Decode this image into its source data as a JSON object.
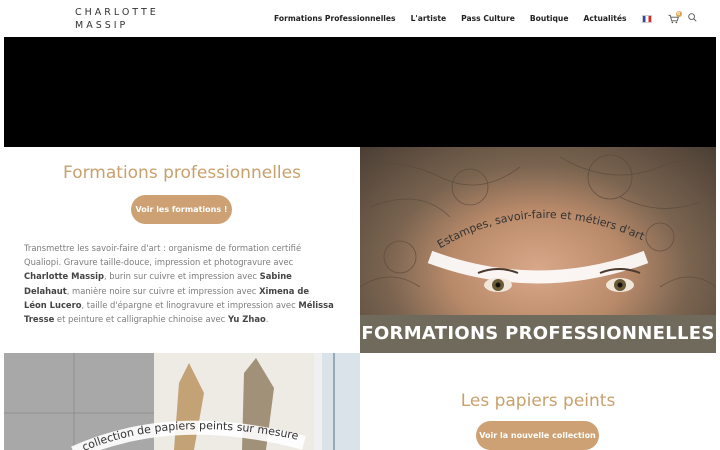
{
  "header": {
    "logo_line1": "CHARLOTTE",
    "logo_line2": "MASSIP",
    "nav": [
      "Formations Professionnelles",
      "L'artiste",
      "Pass Culture",
      "Boutique",
      "Actualités"
    ],
    "cart_count": "0"
  },
  "section1": {
    "title": "Formations professionnelles",
    "button": "Voir les formations !",
    "para": [
      {
        "t": "Transmettre les savoir-faire d'art : organisme de formation certifié Qualiopi. Gravure taille-douce, impression et photogravure avec ",
        "b": false
      },
      {
        "t": "Charlotte Massip",
        "b": true
      },
      {
        "t": ", burin sur cuivre et impression avec ",
        "b": false
      },
      {
        "t": "Sabine Delahaut",
        "b": true
      },
      {
        "t": ", manière noire sur cuivre et impression avec ",
        "b": false
      },
      {
        "t": "Ximena de Léon Lucero",
        "b": true
      },
      {
        "t": ", taille d'épargne et linogravure et impression avec ",
        "b": false
      },
      {
        "t": "Mélissa Tresse",
        "b": true
      },
      {
        "t": " et peinture et calligraphie chinoise avec ",
        "b": false
      },
      {
        "t": "Yu Zhao",
        "b": true
      },
      {
        "t": ".",
        "b": false
      }
    ],
    "image_arc_text": "Estampes, savoir-faire et métiers d'art",
    "image_banner": "FORMATIONS PROFESSIONNELLES"
  },
  "section2": {
    "image_arc_text": "collection de papiers peints sur mesure",
    "title": "Les papiers peints",
    "button": "Voir la nouvelle collection"
  }
}
